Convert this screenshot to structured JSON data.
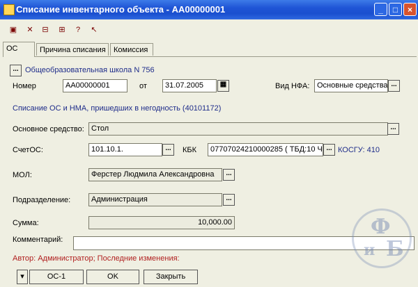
{
  "window": {
    "title": "Списание инвентарного объекта - АА00000001"
  },
  "toolbar": {
    "icons": [
      "doc-post-icon",
      "cancel-post-icon",
      "doc-move-icon",
      "doc-structure-icon",
      "help-icon",
      "context-help-icon"
    ]
  },
  "tabs": [
    {
      "label": "ОС"
    },
    {
      "label": "Причина списания"
    },
    {
      "label": "Комиссия"
    }
  ],
  "form": {
    "org_name": "Общеобразовательная школа N 756",
    "number_label": "Номер",
    "number_value": "АА00000001",
    "date_label": "от",
    "date_value": "31.07.2005",
    "nfa_label": "Вид НФА:",
    "nfa_value": "Основные средства",
    "operation_text": "Списание ОС и НМА, пришедших в негодность (40101172)",
    "asset_label": "Основное средство:",
    "asset_value": "Стол",
    "account_label": "СчетОС:",
    "account_value": "101.10.1.",
    "kbk_label": "КБК",
    "kbk_value": "07707024210000285 ( ТБД:10 Ч",
    "kosgu_text": "КОСГУ: 410",
    "mol_label": "МОЛ:",
    "mol_value": "Ферстер Людмила Александровна",
    "dept_label": "Подразделение:",
    "dept_value": "Администрация",
    "sum_label": "Сумма:",
    "sum_value": "10,000.00",
    "comment_label": "Комментарий:",
    "comment_value": "",
    "author_text": "Автор: Администратор; Последние изменения:"
  },
  "buttons": {
    "os1": "ОС-1",
    "ok": "OK",
    "close": "Закрыть"
  },
  "watermark": {
    "top": "Ф",
    "left": "и",
    "right": "Б"
  }
}
